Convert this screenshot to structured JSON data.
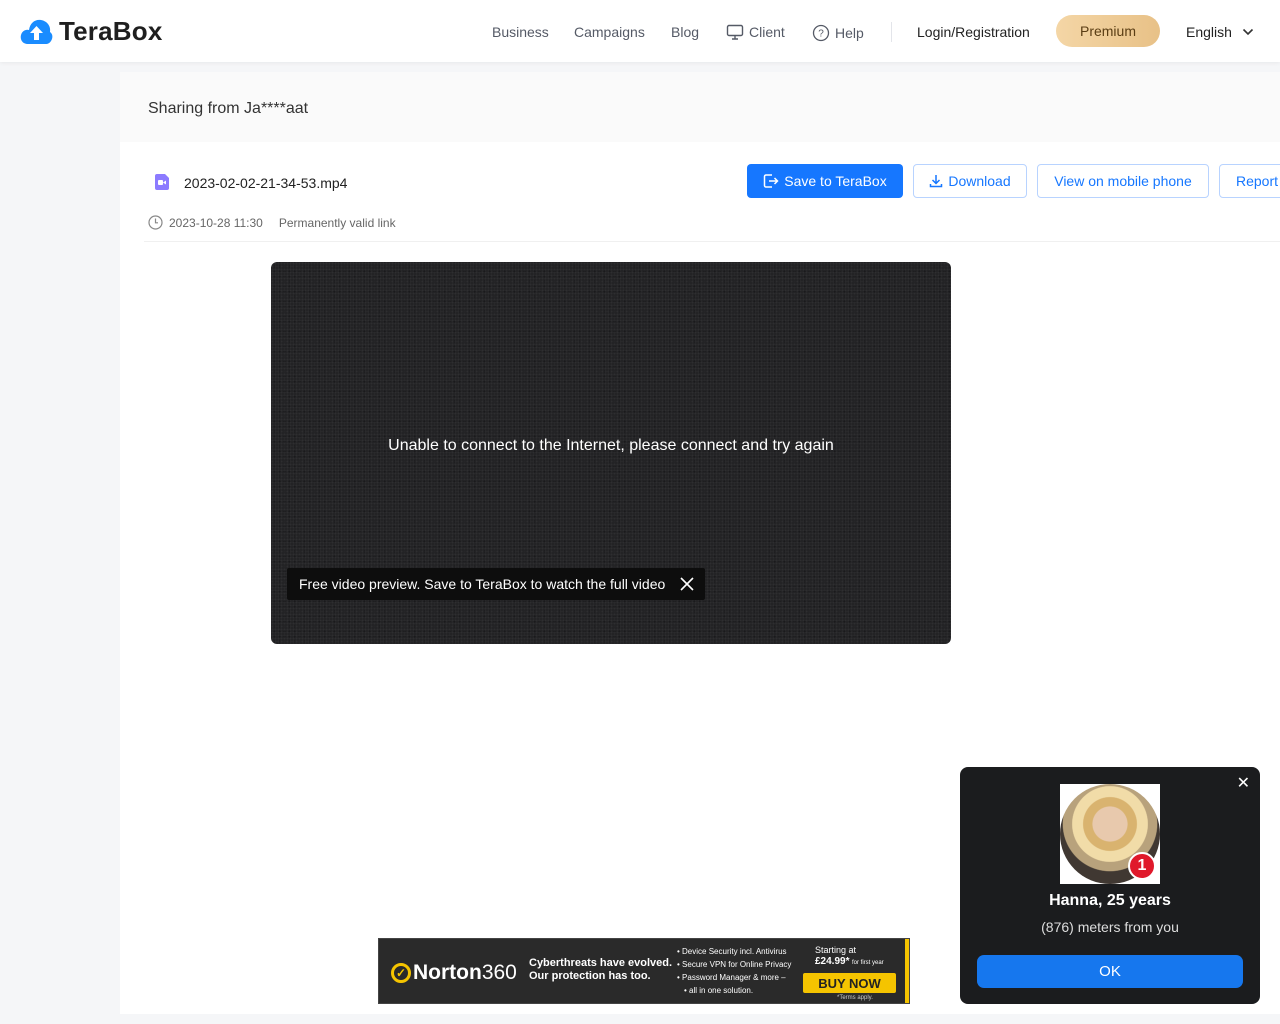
{
  "header": {
    "logo_text": "TeraBox",
    "nav": {
      "business": "Business",
      "campaigns": "Campaigns",
      "blog": "Blog",
      "client": "Client",
      "help": "Help"
    },
    "login": "Login/Registration",
    "premium": "Premium",
    "language": "English"
  },
  "share": {
    "title": "Sharing from Ja****aat",
    "file_name": "2023-02-02-21-34-53.mp4",
    "date": "2023-10-28 11:30",
    "validity": "Permanently valid link",
    "buttons": {
      "save": "Save to TeraBox",
      "download": "Download",
      "mobile": "View on mobile phone",
      "report": "Report"
    }
  },
  "video": {
    "message": "Unable to connect to the Internet, please connect and try again",
    "preview_tip": "Free video preview. Save to TeraBox to watch the full video"
  },
  "ad": {
    "brand": "Norton",
    "brand_num": "360",
    "tagline_1": "Cyberthreats have evolved.",
    "tagline_2": "Our protection has too.",
    "bullets": [
      "Device Security incl. Antivirus",
      "Secure VPN for Online Privacy",
      "Password Manager & more –",
      "all in one solution."
    ],
    "price_label": "Starting at",
    "price": "£24.99*",
    "price_note": "for first year",
    "cta": "BUY NOW",
    "terms": "*Terms apply."
  },
  "popup": {
    "badge_count": "1",
    "name": "Hanna, 25 years",
    "distance": "(876) meters from you",
    "ok": "OK",
    "close": "✕"
  },
  "colors": {
    "primary": "#1677ff",
    "premium_gold": "#e8c187",
    "norton_yellow": "#f5c400"
  }
}
